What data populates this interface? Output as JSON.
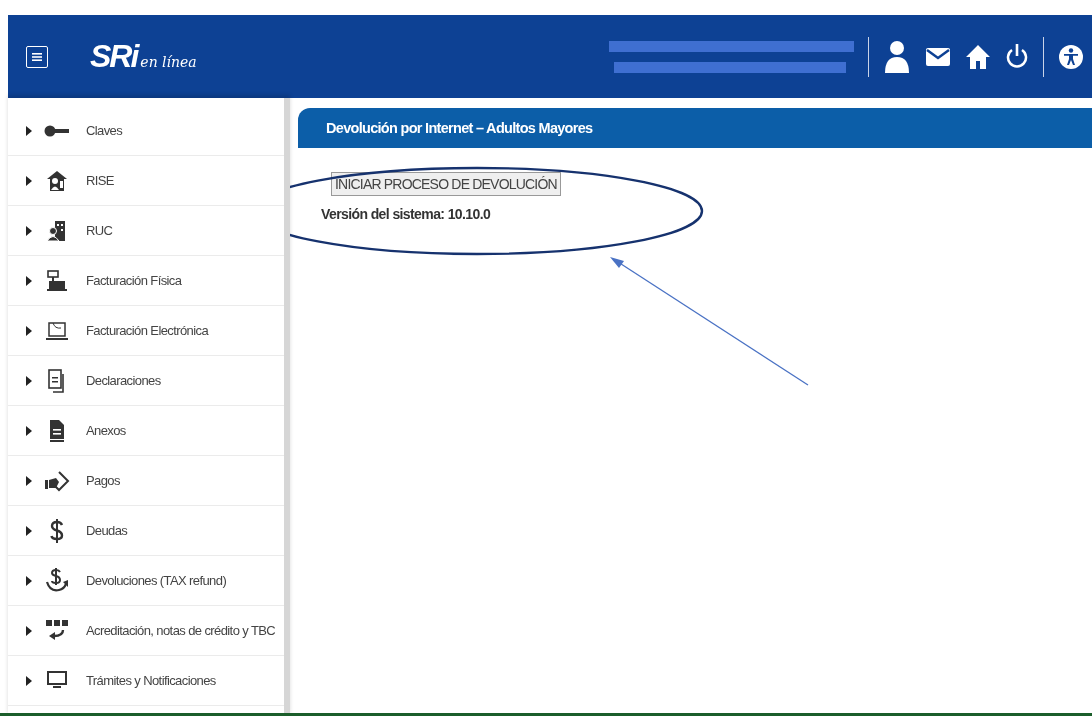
{
  "header": {
    "logo": {
      "brand": "SRi",
      "tagline": "en línea"
    }
  },
  "sidebar": {
    "items": [
      {
        "label": "Claves"
      },
      {
        "label": "RISE"
      },
      {
        "label": "RUC"
      },
      {
        "label": "Facturación Física"
      },
      {
        "label": "Facturación Electrónica"
      },
      {
        "label": "Declaraciones"
      },
      {
        "label": "Anexos"
      },
      {
        "label": "Pagos"
      },
      {
        "label": "Deudas"
      },
      {
        "label": "Devoluciones (TAX refund)"
      },
      {
        "label": "Acreditación, notas de crédito y TBC"
      },
      {
        "label": "Trámites y Notificaciones"
      }
    ]
  },
  "panel": {
    "title": "Devolución por Internet – Adultos Mayores",
    "button": "INICIAR PROCESO DE DEVOLUCIÓN",
    "version": "Versión del sistema: 10.10.0"
  }
}
